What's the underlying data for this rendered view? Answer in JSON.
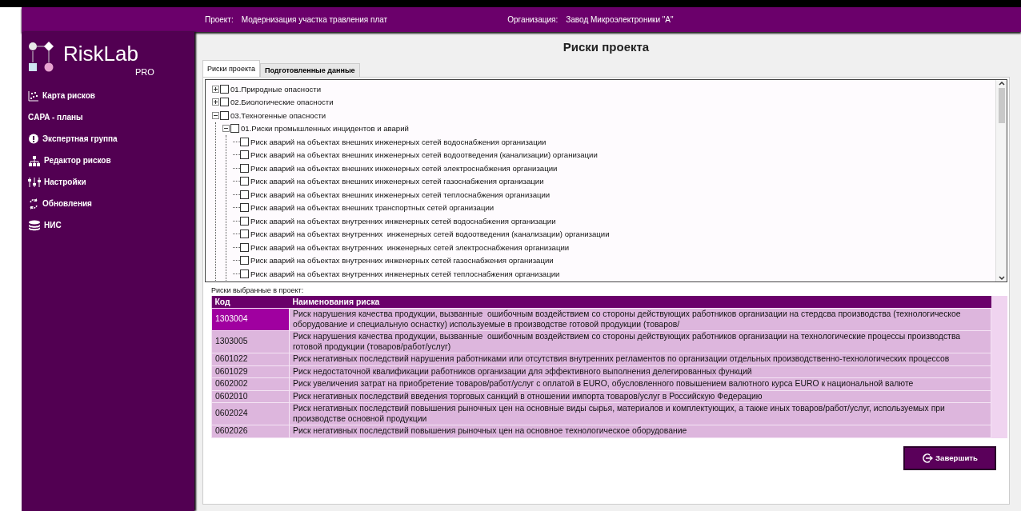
{
  "header": {
    "project_label": "Проект:",
    "project": "Модернизация участка травления плат",
    "org_label": "Организация:",
    "org": "Завод Микроэлектроники \"А\""
  },
  "logo": {
    "name": "RiskLab",
    "suffix": "PRO"
  },
  "sidebar": {
    "items": [
      {
        "label": "Карта рисков"
      },
      {
        "label": "CAPA - планы"
      },
      {
        "label": "Экспертная группа"
      },
      {
        "label": "Редактор рисков"
      },
      {
        "label": "Настройки"
      },
      {
        "label": "Обновления"
      },
      {
        "label": "НИС"
      }
    ]
  },
  "page_title": "Риски проекта",
  "tabs": [
    {
      "label": "Риски проекта",
      "selected": true
    },
    {
      "label": "Подготовленные данные",
      "selected": false
    }
  ],
  "tree": [
    {
      "label": "01.Природные опасности",
      "expanded": false,
      "checked": false
    },
    {
      "label": "02.Биологические опасности",
      "expanded": false,
      "checked": false
    },
    {
      "label": "03.Техногенные опасности",
      "expanded": true,
      "checked": false,
      "children": [
        {
          "label": "01.Риски промышленных инцидентов и аварий",
          "expanded": true,
          "checked": false,
          "children": [
            {
              "label": "Риск аварий на объектах внешних инженерных сетей водоснабжения организации",
              "checked": false
            },
            {
              "label": "Риск аварий на объектах внешних инженерных сетей водоотведения (канализации) организации",
              "checked": false
            },
            {
              "label": "Риск аварий на объектах внешних инженерных сетей электроснабжения организации",
              "checked": false
            },
            {
              "label": "Риск аварий на объектах внешних инженерных сетей газоснабжения организации",
              "checked": false
            },
            {
              "label": "Риск аварий на объектах внешних инженерных сетей теплоснабжения организации",
              "checked": false
            },
            {
              "label": "Риск аварий на объектах внешних транспортных сетей организации",
              "checked": false
            },
            {
              "label": "Риск аварий на объектах внутренних инженерных сетей водоснабжения организации",
              "checked": false
            },
            {
              "label": "Риск аварий на объектах внутренних  инженерных сетей водоотведения (канализации) организации",
              "checked": false
            },
            {
              "label": "Риск аварий на объектах внутренних  инженерных сетей электроснабжения организации",
              "checked": false
            },
            {
              "label": "Риск аварий на объектах внутренних инженерных сетей газоснабжения организации",
              "checked": false
            },
            {
              "label": "Риск аварий на объектах внутренних инженерных сетей теплоснабжения организации",
              "checked": false
            }
          ]
        }
      ]
    }
  ],
  "selected_label": "Риски выбранные в проект:",
  "table": {
    "columns": [
      "Код",
      "Наименования риска"
    ],
    "rows": [
      {
        "code": "1303004",
        "name": "Риск нарушения качества продукции, вызванные  ошибочным воздействием со стороны действующих работников организации на стердсва производства (технологическое оборудование и специальную оснастку) используемые в производстве готовой продукции (товаров/",
        "selected": true
      },
      {
        "code": "1303005",
        "name": "Риск нарушения качества продукции, вызванные  ошибочным воздействием со стороны действующих работников организации на технологические процессы производства готовой продукции (товаров/работ/услуг)",
        "selected": false
      },
      {
        "code": "0601022",
        "name": "Риск негативных последствий нарушения работниками или отсутствия внутренних регламентов по организации отдельных производственно-технологических процессов",
        "selected": false
      },
      {
        "code": "0601029",
        "name": "Риск недостаточной квалификации работников организации для эффективного выполнения делегированных функций",
        "selected": false
      },
      {
        "code": "0602002",
        "name": "Риск увеличения затрат на приобретение товаров/работ/услуг с оплатой в EURO, обусловленного повышением валютного курса EURO к национальной валюте",
        "selected": false
      },
      {
        "code": "0602010",
        "name": "Риск негативных последствий введения торговых санкций в отношении импорта товаров/услуг в Российскую Федерацию",
        "selected": false
      },
      {
        "code": "0602024",
        "name": "Риск негативных последствий повышения рыночных цен на основные виды сырья, материалов и комплектующих, а также иных товаров/работ/услуг, используемых при производстве основной продукции",
        "selected": false
      },
      {
        "code": "0602026",
        "name": "Риск негативных последствий повышения рыночных цен на основное технологическое оборудование",
        "selected": false
      }
    ]
  },
  "finish_button": "Завершить"
}
